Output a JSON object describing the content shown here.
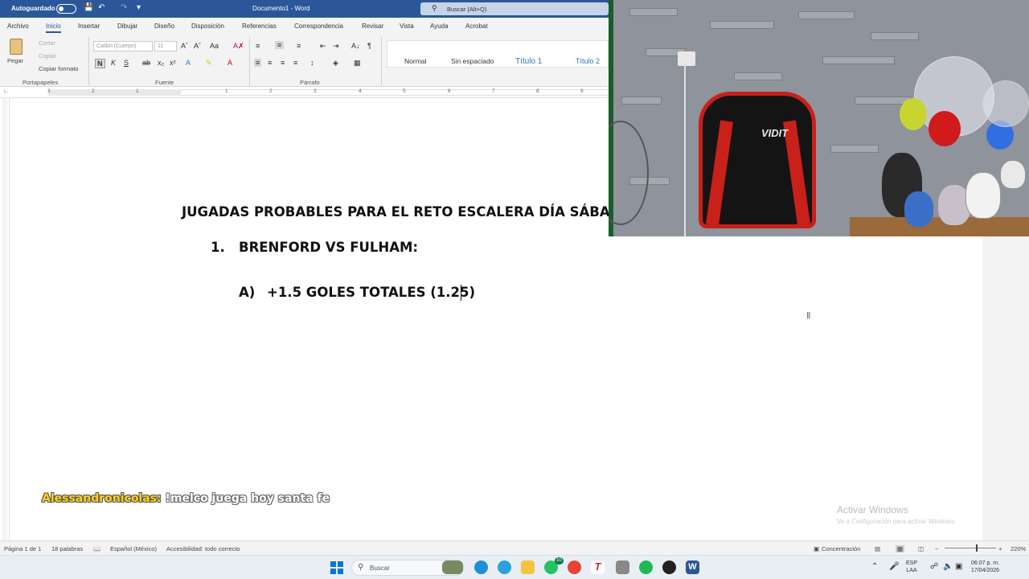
{
  "window": {
    "autosave_label": "Autoguardado",
    "doc_title": "Documento1  -  Word",
    "search_placeholder": "Buscar (Alt+Q)"
  },
  "ribbon": {
    "tabs": [
      "Archivo",
      "Inicio",
      "Insertar",
      "Dibujar",
      "Diseño",
      "Disposición",
      "Referencias",
      "Correspondencia",
      "Revisar",
      "Vista",
      "Ayuda",
      "Acrobat"
    ],
    "active_tab": "Inicio",
    "clipboard": {
      "paste": "Pegar",
      "cut": "Cortar",
      "copy": "Copiar",
      "format_painter": "Copiar formato",
      "group_label": "Portapapeles"
    },
    "font": {
      "name": "Calibri (Cuerpo)",
      "size": "11",
      "group_label": "Fuente"
    },
    "paragraph": {
      "group_label": "Párrafo"
    },
    "styles": [
      "Normal",
      "Sin espaciado",
      "Título 1",
      "Título 2"
    ]
  },
  "ruler": {
    "numbers": [
      "3",
      "2",
      "1",
      "1",
      "2",
      "3",
      "4",
      "5",
      "6",
      "7",
      "8",
      "9"
    ]
  },
  "document": {
    "line1": "JUGADAS PROBABLES PARA EL RETO ESCALERA DÍA SÁBADO",
    "item_number": "1.",
    "item_text": "BRENFORD VS FULHAM:",
    "sub_letter": "A)",
    "sub_text": "+1.5 GOLES TOTALES (1.25)"
  },
  "chat": {
    "user": "Alessandronicolas:",
    "message": "!melco juega hoy santa fe"
  },
  "watermark": {
    "title": "Activar Windows",
    "subtitle": "Ve a Configuración para activar Windows."
  },
  "status": {
    "page": "Página 1 de 1",
    "words": "18 palabras",
    "language": "Español (México)",
    "accessibility": "Accesibilidad: todo correcto",
    "focus": "Concentración",
    "zoom": "220%"
  },
  "taskbar": {
    "search": "Buscar",
    "whatsapp_badge": "10",
    "lang_top": "ESP",
    "lang_bottom": "LAA",
    "time": "06:07 p. m.",
    "date": "17/04/2026"
  },
  "webcam": {
    "chair_logo": "VIDIT"
  },
  "colors": {
    "word_blue": "#2b579a",
    "chat_user": "#ffd21f",
    "chair_red": "#c9201a"
  }
}
